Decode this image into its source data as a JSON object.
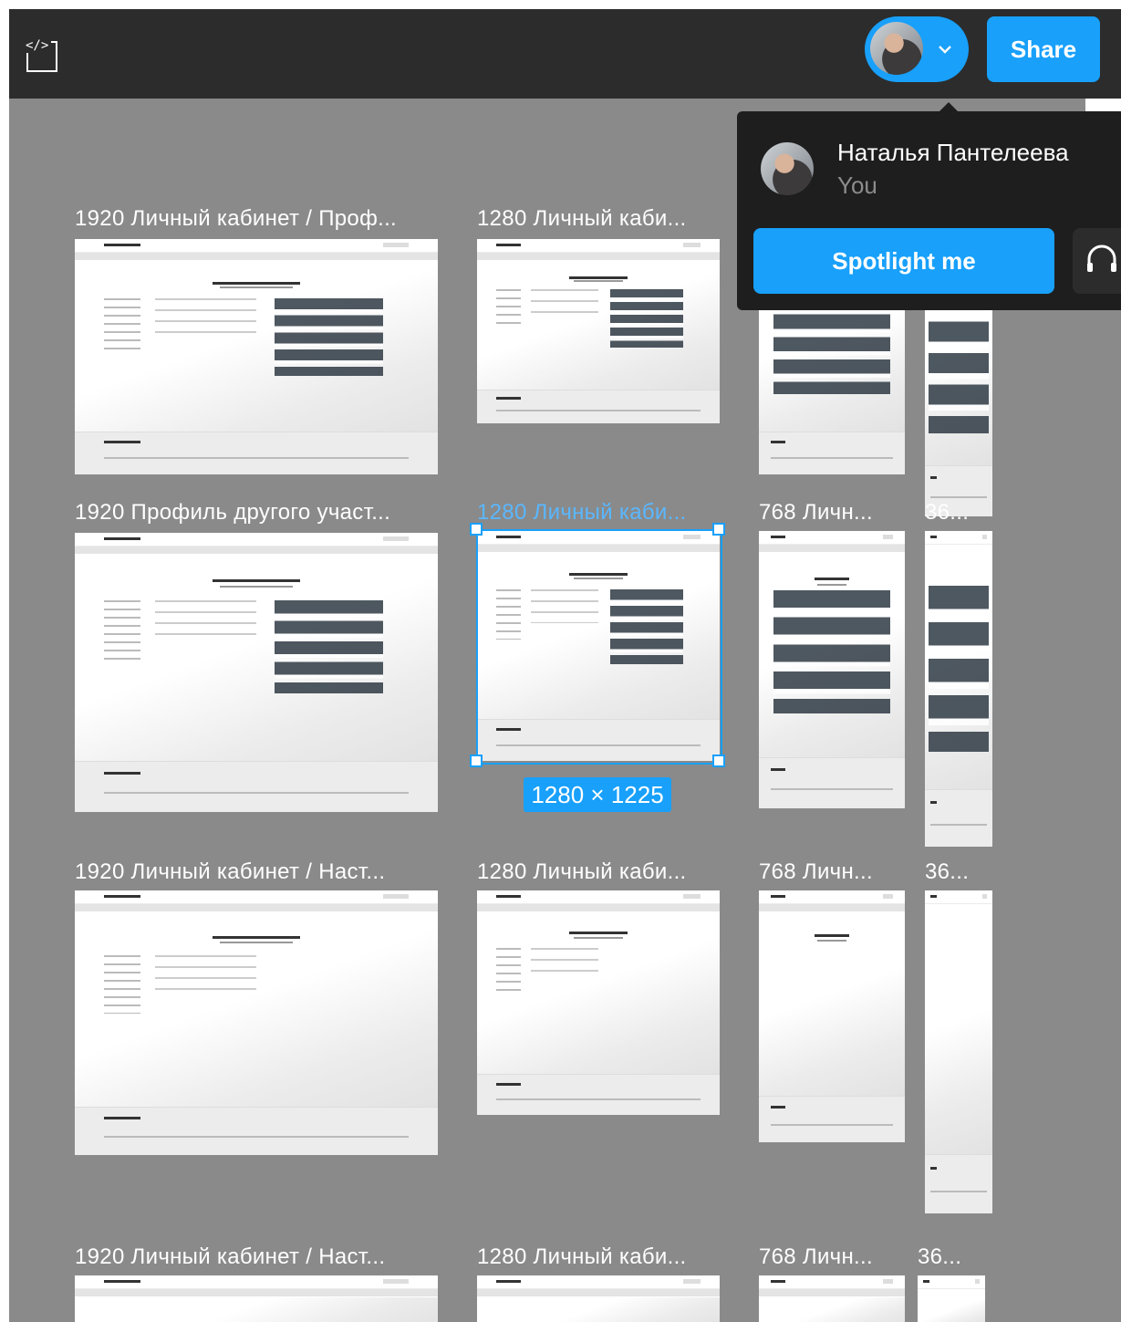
{
  "toolbar": {
    "share_label": "Share"
  },
  "frames": {
    "r1c1": "1920 Личный кабинет / Проф...",
    "r1c2": "1280 Личный каби...",
    "r2c1": "1920 Профиль другого участ...",
    "r2c2": "1280 Личный каби...",
    "r2c3": "768 Личн...",
    "r2c4": "36...",
    "r3c1": "1920 Личный кабинет / Наст...",
    "r3c2": "1280 Личный каби...",
    "r3c3": "768 Личн...",
    "r3c4": "36...",
    "r4c1": "1920 Личный кабинет / Наст...",
    "r4c2": "1280 Личный каби...",
    "r4c3": "768 Личн...",
    "r4c4": "36..."
  },
  "selection": {
    "dimensions": "1280 × 1225"
  },
  "popup": {
    "user_name": "Наталья Пантелеева",
    "user_role": "You",
    "spotlight_label": "Spotlight me"
  },
  "colors": {
    "accent": "#18a0fb",
    "toolbar": "#2c2c2c",
    "canvas": "#8a8a8a"
  }
}
